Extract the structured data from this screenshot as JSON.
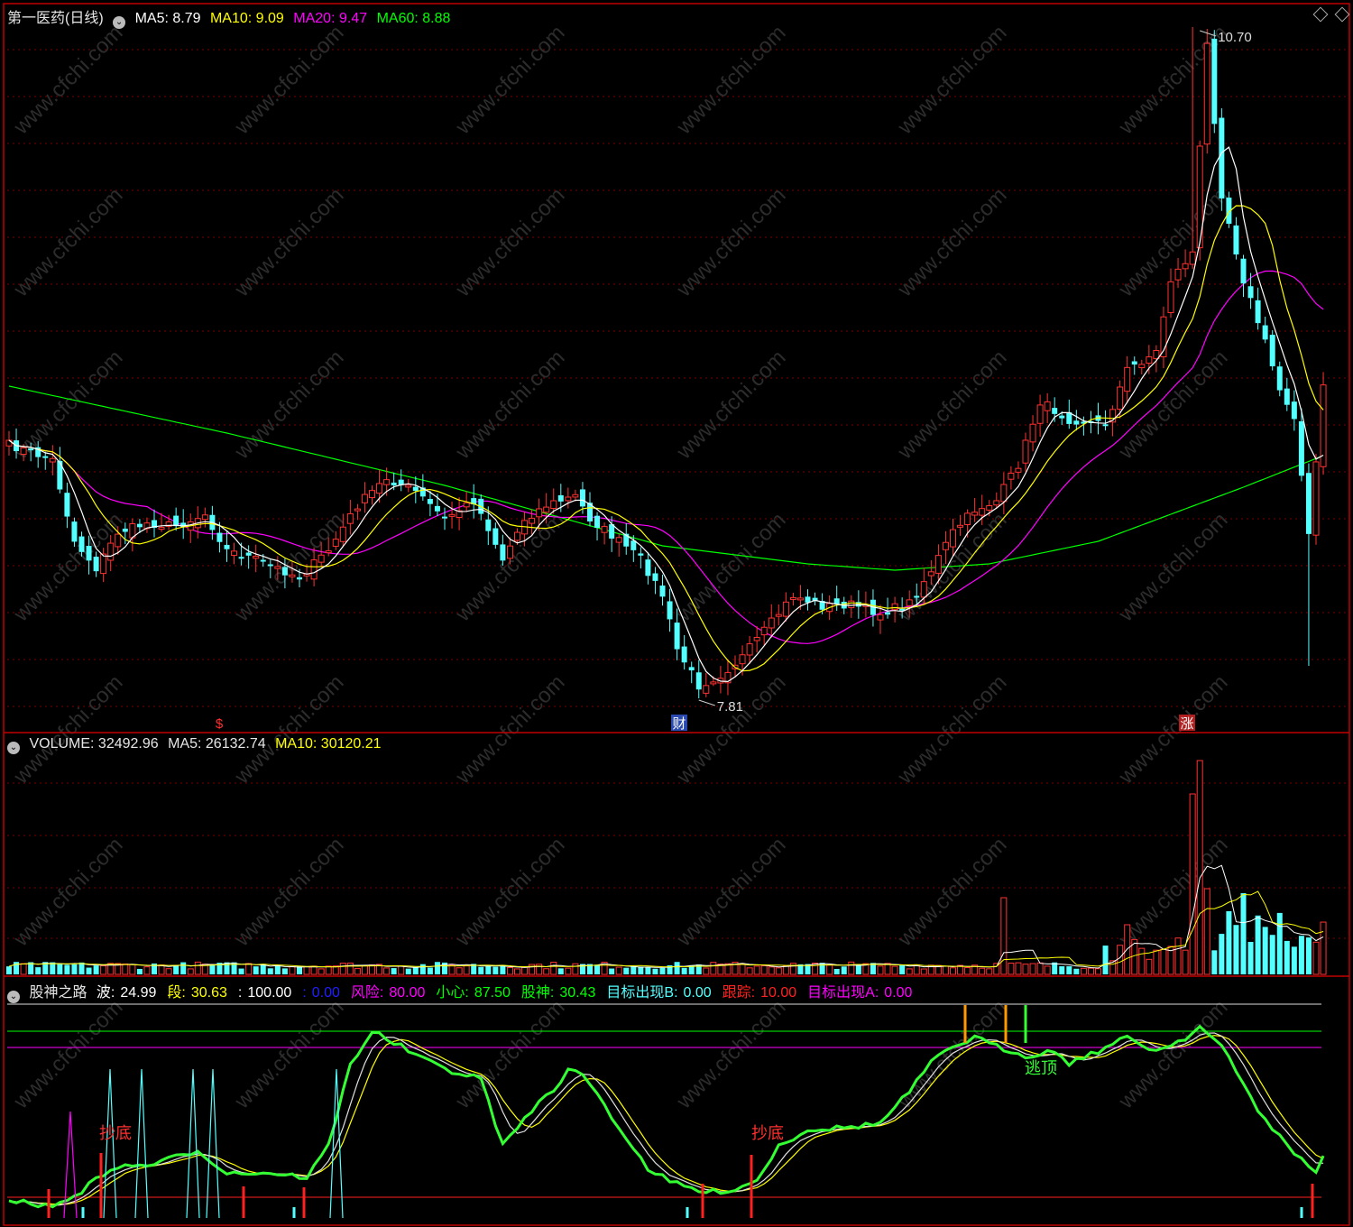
{
  "colors": {
    "up": "#ff3333",
    "down": "#54ffff",
    "ma5": "#ffffff",
    "ma10": "#ffff00",
    "ma20": "#ff00ff",
    "ma60": "#00ff00",
    "frame": "#c00000",
    "grid": "#7a0000"
  },
  "price_panel": {
    "stock": "第一医药(日线)",
    "ma5_label": "MA5:",
    "ma5": "8.79",
    "ma10_label": "MA10:",
    "ma10": "9.09",
    "ma20_label": "MA20:",
    "ma20": "9.47",
    "ma60_label": "MA60:",
    "ma60": "8.88",
    "high_mark": "10.70",
    "low_mark": "7.81",
    "event_tags": [
      "$",
      "财",
      "涨"
    ]
  },
  "volume_panel": {
    "label": "VOLUME:",
    "value": "32492.96",
    "ma5_label": "MA5:",
    "ma5": "26132.74",
    "ma10_label": "MA10:",
    "ma10": "30120.21"
  },
  "indicator_panel": {
    "name": "股神之路",
    "items": [
      {
        "label": "波:",
        "value": "24.99",
        "color": "#ffffff"
      },
      {
        "label": "段:",
        "value": "30.63",
        "color": "#ffff00"
      },
      {
        "label": ":",
        "value": "100.00",
        "color": "#ffffff"
      },
      {
        "label": ":",
        "value": "0.00",
        "color": "#2020ff"
      },
      {
        "label": "风险:",
        "value": "80.00",
        "color": "#ff00ff"
      },
      {
        "label": "小心:",
        "value": "87.50",
        "color": "#00ff00"
      },
      {
        "label": "股神:",
        "value": "30.43",
        "color": "#00ff00"
      },
      {
        "label": "目标出现B:",
        "value": "0.00",
        "color": "#54ffff"
      },
      {
        "label": "跟踪:",
        "value": "10.00",
        "color": "#ff2020"
      },
      {
        "label": "目标出现A:",
        "value": "0.00",
        "color": "#ff00ff"
      }
    ],
    "annotations": [
      "抄底",
      "抄底",
      "逃顶"
    ]
  },
  "watermark": "www.cfchi.com",
  "chart_data": [
    {
      "type": "candlestick",
      "title": "第一医药(日线)",
      "series": [
        {
          "name": "MA5",
          "last": 8.79
        },
        {
          "name": "MA10",
          "last": 9.09
        },
        {
          "name": "MA20",
          "last": 9.47
        },
        {
          "name": "MA60",
          "last": 8.88
        }
      ],
      "annotations": [
        {
          "text": "10.70",
          "kind": "high"
        },
        {
          "text": "7.81",
          "kind": "low"
        }
      ]
    },
    {
      "type": "bar",
      "title": "VOLUME",
      "series": [
        {
          "name": "VOLUME",
          "last": 32492.96
        },
        {
          "name": "MA5",
          "last": 26132.74
        },
        {
          "name": "MA10",
          "last": 30120.21
        }
      ]
    },
    {
      "type": "line",
      "title": "股神之路",
      "series": [
        {
          "name": "波",
          "last": 24.99
        },
        {
          "name": "段",
          "last": 30.63
        },
        {
          "name": "风险",
          "last": 80.0
        },
        {
          "name": "小心",
          "last": 87.5
        },
        {
          "name": "股神",
          "last": 30.43
        },
        {
          "name": "目标出现B",
          "last": 0.0
        },
        {
          "name": "跟踪",
          "last": 10.0
        },
        {
          "name": "目标出现A",
          "last": 0.0
        }
      ]
    }
  ]
}
